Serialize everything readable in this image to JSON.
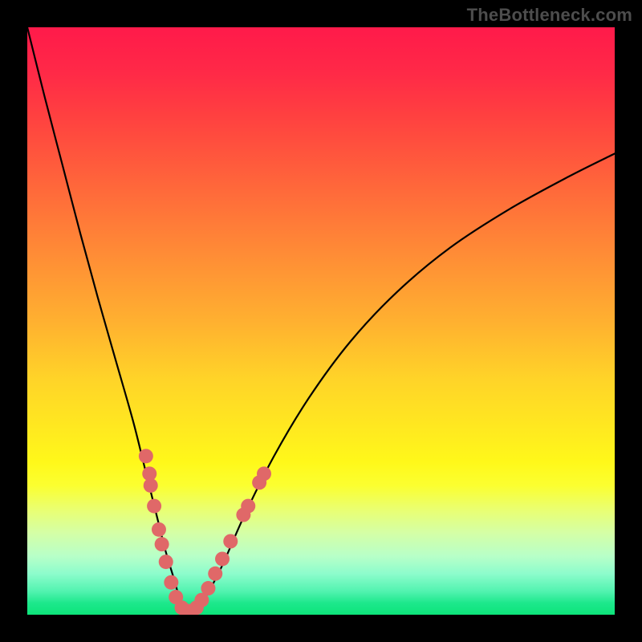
{
  "watermark": "TheBottleneck.com",
  "colors": {
    "frame": "#000000",
    "curve": "#000000",
    "dot": "#e06868",
    "watermark": "#4d4d4d"
  },
  "chart_data": {
    "type": "line",
    "title": "",
    "xlabel": "",
    "ylabel": "",
    "xlim": [
      0,
      100
    ],
    "ylim": [
      0,
      100
    ],
    "grid": false,
    "legend": false,
    "series": [
      {
        "name": "bottleneck-curve",
        "x": [
          0,
          3,
          6,
          9,
          12,
          15,
          18,
          20,
          22,
          23.5,
          25,
          26,
          27,
          28,
          30,
          33,
          37,
          42,
          48,
          55,
          63,
          72,
          82,
          92,
          100
        ],
        "y": [
          100,
          88,
          76.5,
          65,
          54,
          43.5,
          33,
          25,
          17,
          11,
          6,
          2.5,
          0.5,
          0.5,
          2.5,
          8,
          17,
          27,
          37,
          46.5,
          55,
          62.5,
          69,
          74.5,
          78.5
        ]
      }
    ],
    "points": [
      {
        "x": 20.2,
        "y": 27.0
      },
      {
        "x": 20.8,
        "y": 24.0
      },
      {
        "x": 21.0,
        "y": 22.0
      },
      {
        "x": 21.6,
        "y": 18.5
      },
      {
        "x": 22.4,
        "y": 14.5
      },
      {
        "x": 22.9,
        "y": 12.0
      },
      {
        "x": 23.6,
        "y": 9.0
      },
      {
        "x": 24.5,
        "y": 5.5
      },
      {
        "x": 25.3,
        "y": 3.0
      },
      {
        "x": 26.3,
        "y": 1.2
      },
      {
        "x": 27.5,
        "y": 0.6
      },
      {
        "x": 28.8,
        "y": 1.2
      },
      {
        "x": 29.7,
        "y": 2.5
      },
      {
        "x": 30.8,
        "y": 4.5
      },
      {
        "x": 32.0,
        "y": 7.0
      },
      {
        "x": 33.2,
        "y": 9.5
      },
      {
        "x": 34.6,
        "y": 12.5
      },
      {
        "x": 36.8,
        "y": 17.0
      },
      {
        "x": 37.6,
        "y": 18.5
      },
      {
        "x": 39.5,
        "y": 22.5
      },
      {
        "x": 40.3,
        "y": 24.0
      }
    ],
    "annotations": []
  }
}
